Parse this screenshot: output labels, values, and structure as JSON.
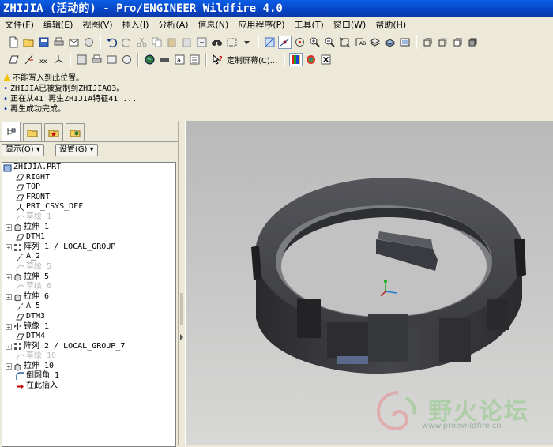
{
  "window": {
    "title": "ZHIJIA (活动的) - Pro/ENGINEER Wildfire 4.0"
  },
  "menu": [
    {
      "label": "文件(F)"
    },
    {
      "label": "编辑(E)"
    },
    {
      "label": "视图(V)"
    },
    {
      "label": "插入(I)"
    },
    {
      "label": "分析(A)"
    },
    {
      "label": "信息(N)"
    },
    {
      "label": "应用程序(P)"
    },
    {
      "label": "工具(T)"
    },
    {
      "label": "窗口(W)"
    },
    {
      "label": "帮助(H)"
    }
  ],
  "toolbar2": {
    "customize_label": "定制屏幕(C)..."
  },
  "messages": [
    {
      "text": "不能写入到此位置。"
    },
    {
      "text": "ZHIJIA已被复制到ZHIJIA03。"
    },
    {
      "text": "正在从41 再生ZHIJIA特征41 ..."
    },
    {
      "text": "再生成功完成。"
    }
  ],
  "navigator": {
    "show_label": "显示(O)",
    "settings_label": "设置(G)"
  },
  "tree": [
    {
      "label": "ZHIJIA.PRT"
    },
    {
      "label": "RIGHT"
    },
    {
      "label": "TOP"
    },
    {
      "label": "FRONT"
    },
    {
      "label": "PRT_CSYS_DEF"
    },
    {
      "label": "草绘 1"
    },
    {
      "label": "拉伸 1"
    },
    {
      "label": "DTM1"
    },
    {
      "label": "阵列 1 / LOCAL_GROUP"
    },
    {
      "label": "A_2"
    },
    {
      "label": "草绘 5"
    },
    {
      "label": "拉伸 5"
    },
    {
      "label": "草绘 6"
    },
    {
      "label": "拉伸 6"
    },
    {
      "label": "A_5"
    },
    {
      "label": "DTM3"
    },
    {
      "label": "镜像 1"
    },
    {
      "label": "DTM4"
    },
    {
      "label": "阵列 2 / LOCAL_GROUP_7"
    },
    {
      "label": "草绘 10"
    },
    {
      "label": "拉伸 10"
    },
    {
      "label": "倒圆角 1"
    },
    {
      "label": "在此插入"
    }
  ],
  "watermark": {
    "name": "野火论坛",
    "url": "www.proewildfire.cn"
  }
}
